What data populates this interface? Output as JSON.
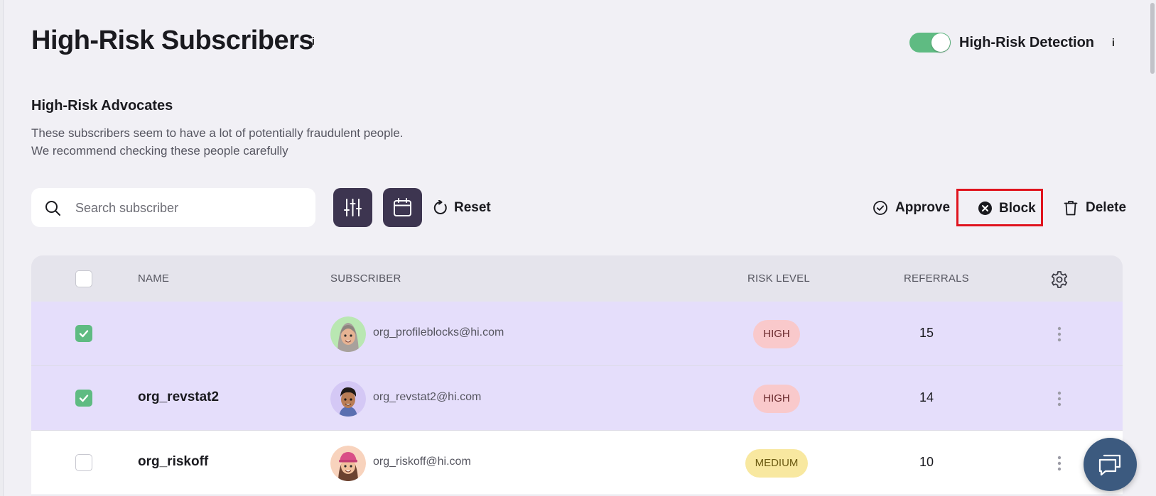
{
  "page": {
    "title": "High-Risk Subscribers",
    "info_glyph": "i",
    "detection_toggle": {
      "label": "High-Risk Detection",
      "on": true,
      "color": "#5fbb82"
    }
  },
  "section": {
    "title": "High-Risk Advocates",
    "description_line1": "These subscribers seem to have a lot of potentially fraudulent people.",
    "description_line2": "We recommend checking these people carefully"
  },
  "toolbar": {
    "search_placeholder": "Search subscriber",
    "search_value": "",
    "filter_icon": "sliders-icon",
    "calendar_icon": "calendar-icon",
    "reset_label": "Reset",
    "approve_label": "Approve",
    "block_label": "Block",
    "delete_label": "Delete",
    "highlight_color": "#e0141e"
  },
  "table": {
    "columns": {
      "name": "NAME",
      "subscriber": "SUBSCRIBER",
      "risk_level": "RISK LEVEL",
      "referrals": "REFERRALS"
    },
    "header_checked": false,
    "rows": [
      {
        "checked": true,
        "name": "",
        "email": "org_profileblocks@hi.com",
        "risk": "HIGH",
        "referrals": "15",
        "avatar": "woman-grey-hair-avatar"
      },
      {
        "checked": true,
        "name": "org_revstat2",
        "email": "org_revstat2@hi.com",
        "risk": "HIGH",
        "referrals": "14",
        "avatar": "man-dark-hair-avatar"
      },
      {
        "checked": false,
        "name": "org_riskoff",
        "email": "org_riskoff@hi.com",
        "risk": "MEDIUM",
        "referrals": "10",
        "avatar": "woman-pink-cap-avatar"
      }
    ]
  },
  "colors": {
    "accent_dark": "#3d3550",
    "selected_row": "#e5defb",
    "high_badge": "#f9c9cb",
    "medium_badge": "#f8e8a0",
    "chat_button": "#3c5a7f"
  }
}
